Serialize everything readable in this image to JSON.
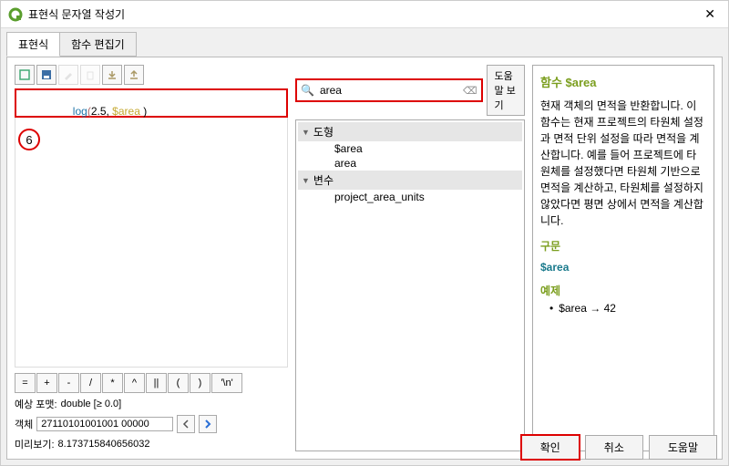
{
  "window": {
    "title": "표현식 문자열 작성기"
  },
  "tabs": {
    "expression": "표현식",
    "func_editor": "함수 편집기"
  },
  "editor": {
    "fn": "log",
    "open": "(",
    "args_left": "2.5, ",
    "var": "$area",
    "args_right": " )",
    "close": ""
  },
  "annot": {
    "circle": "6"
  },
  "operators": [
    "=",
    "+",
    "-",
    "/",
    "*",
    "^",
    "||",
    "(",
    ")",
    "'\\n'"
  ],
  "meta": {
    "expect_label": "예상 포맷:",
    "expect_value": "double [≥ 0.0]",
    "feature_label": "객체",
    "feature_value": "27110101001001 00000",
    "preview_label": "미리보기:",
    "preview_value": "8.173715840656032"
  },
  "search": {
    "value": "area",
    "placeholder": ""
  },
  "buttons": {
    "show_help": "도움말 보기",
    "ok": "확인",
    "cancel": "취소",
    "help": "도움말"
  },
  "tree": {
    "groups": [
      {
        "label": "도형",
        "items": [
          "$area",
          "area"
        ]
      },
      {
        "label": "변수",
        "items": [
          "project_area_units"
        ]
      }
    ]
  },
  "help": {
    "title": "함수 $area",
    "body": "현재 객체의 면적을 반환합니다. 이 함수는 현재 프로젝트의 타원체 설정과 면적 단위 설정을 따라 면적을 계산합니다. 예를 들어 프로젝트에 타원체를 설정했다면 타원체 기반으로 면적을 계산하고, 타원체를 설정하지 않았다면 평면 상에서 면적을 계산합니다.",
    "syntax_label": "구문",
    "syntax": "$area",
    "example_label": "예제",
    "example_code": "$area → 42"
  }
}
